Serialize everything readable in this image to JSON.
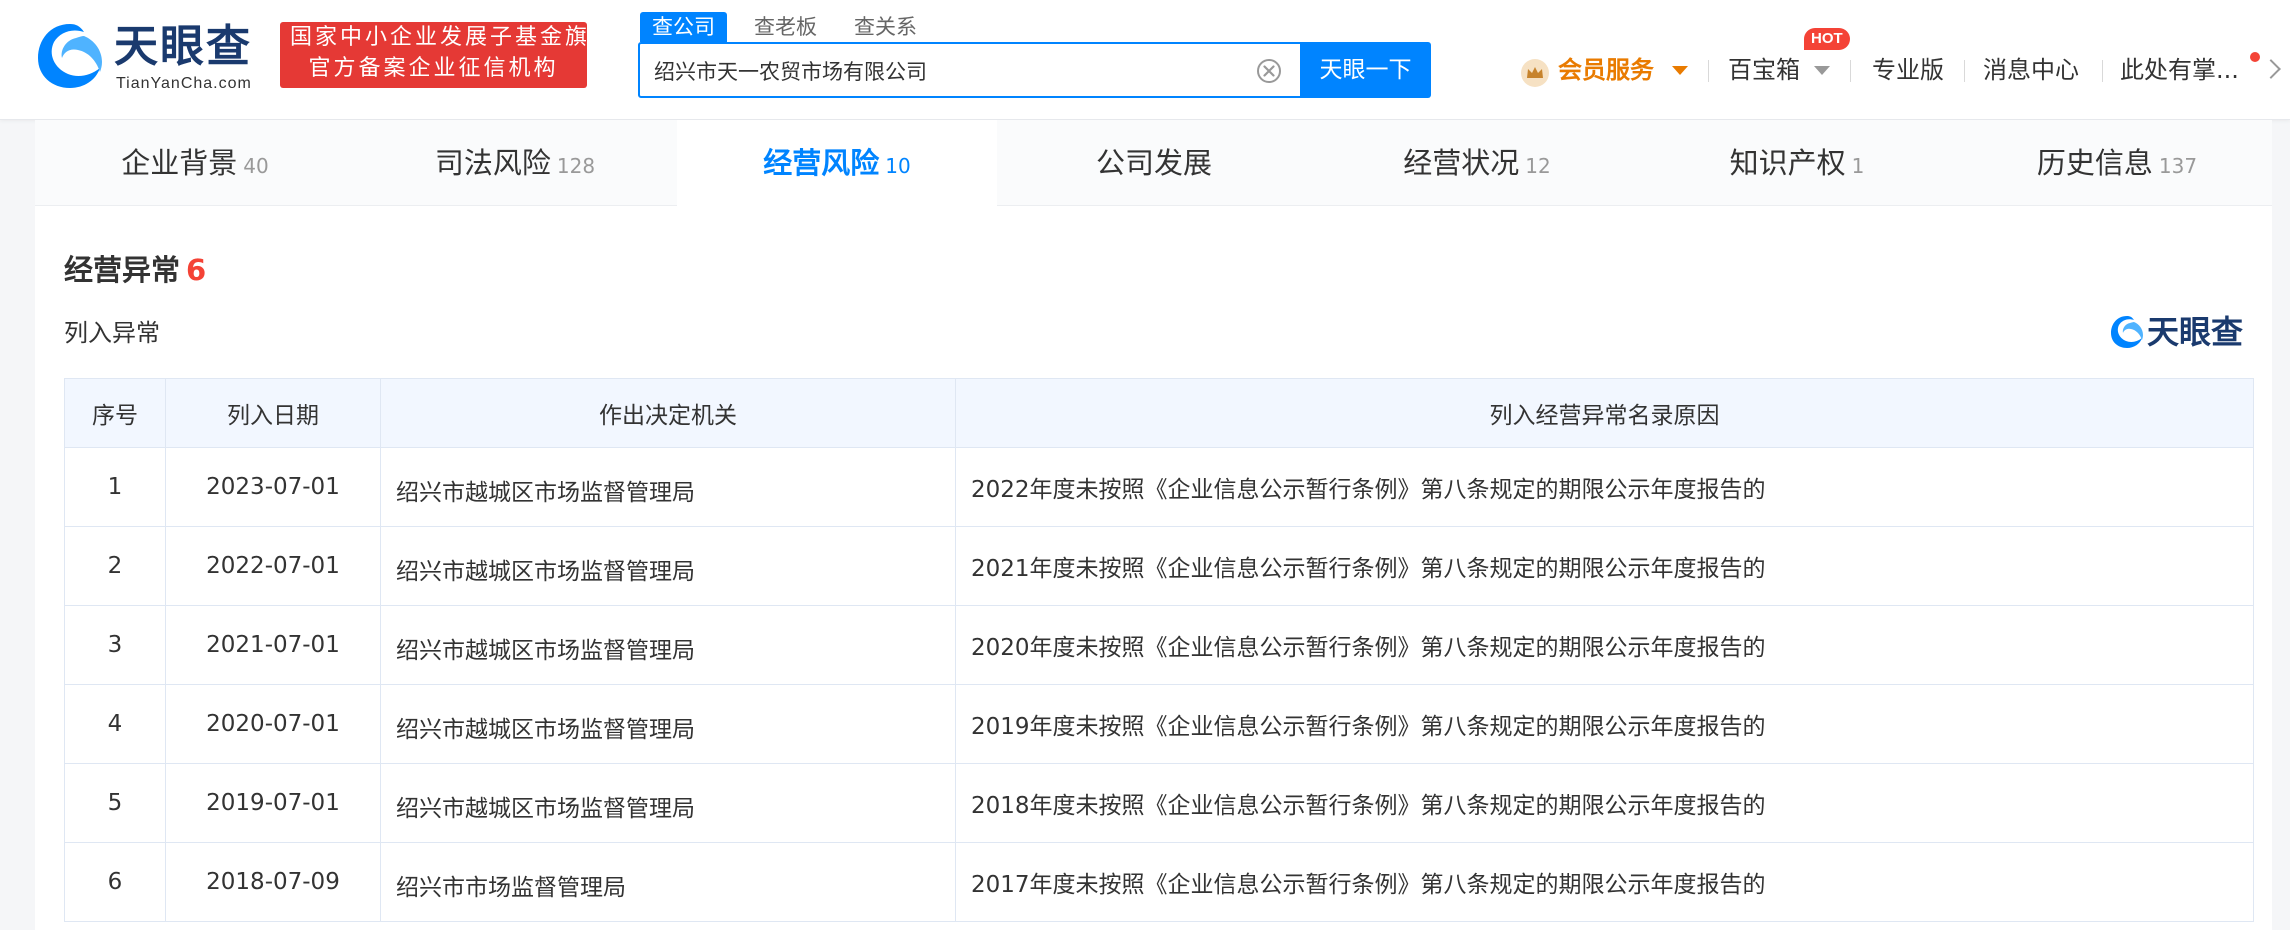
{
  "brand": {
    "name": "天眼查",
    "domain": "TianYanCha.com",
    "badge_line1": "国家中小企业发展子基金旗下",
    "badge_line2": "官方备案企业征信机构"
  },
  "search": {
    "tabs": [
      "查公司",
      "查老板",
      "查关系"
    ],
    "value": "绍兴市天一农贸市场有限公司",
    "button": "天眼一下"
  },
  "nav": {
    "vip": "会员服务",
    "toolbox": "百宝箱",
    "hot": "HOT",
    "pro": "专业版",
    "messages": "消息中心",
    "user": "此处有掌..."
  },
  "tabs": [
    {
      "label": "企业背景",
      "count": "40"
    },
    {
      "label": "司法风险",
      "count": "128"
    },
    {
      "label": "经营风险",
      "count": "10"
    },
    {
      "label": "公司发展",
      "count": ""
    },
    {
      "label": "经营状况",
      "count": "12"
    },
    {
      "label": "知识产权",
      "count": "1"
    },
    {
      "label": "历史信息",
      "count": "137"
    }
  ],
  "section": {
    "title": "经营异常",
    "count": "6",
    "subtitle": "列入异常",
    "watermark": "天眼查"
  },
  "table": {
    "headers": [
      "序号",
      "列入日期",
      "作出决定机关",
      "列入经营异常名录原因"
    ],
    "rows": [
      {
        "idx": "1",
        "date": "2023-07-01",
        "org": "绍兴市越城区市场监督管理局",
        "reason": "2022年度未按照《企业信息公示暂行条例》第八条规定的期限公示年度报告的"
      },
      {
        "idx": "2",
        "date": "2022-07-01",
        "org": "绍兴市越城区市场监督管理局",
        "reason": "2021年度未按照《企业信息公示暂行条例》第八条规定的期限公示年度报告的"
      },
      {
        "idx": "3",
        "date": "2021-07-01",
        "org": "绍兴市越城区市场监督管理局",
        "reason": "2020年度未按照《企业信息公示暂行条例》第八条规定的期限公示年度报告的"
      },
      {
        "idx": "4",
        "date": "2020-07-01",
        "org": "绍兴市越城区市场监督管理局",
        "reason": "2019年度未按照《企业信息公示暂行条例》第八条规定的期限公示年度报告的"
      },
      {
        "idx": "5",
        "date": "2019-07-01",
        "org": "绍兴市越城区市场监督管理局",
        "reason": "2018年度未按照《企业信息公示暂行条例》第八条规定的期限公示年度报告的"
      },
      {
        "idx": "6",
        "date": "2018-07-09",
        "org": "绍兴市市场监督管理局",
        "reason": "2017年度未按照《企业信息公示暂行条例》第八条规定的期限公示年度报告的"
      }
    ]
  },
  "colors": {
    "accent": "#0084ff",
    "brand_dark": "#1a3a6e",
    "badge_red": "#e53935",
    "vip_orange": "#e97b00"
  },
  "icons": [
    "tianyancha-logo-icon",
    "clear-icon",
    "vip-crown-icon",
    "chevron-down-icon",
    "chevron-right-icon"
  ]
}
